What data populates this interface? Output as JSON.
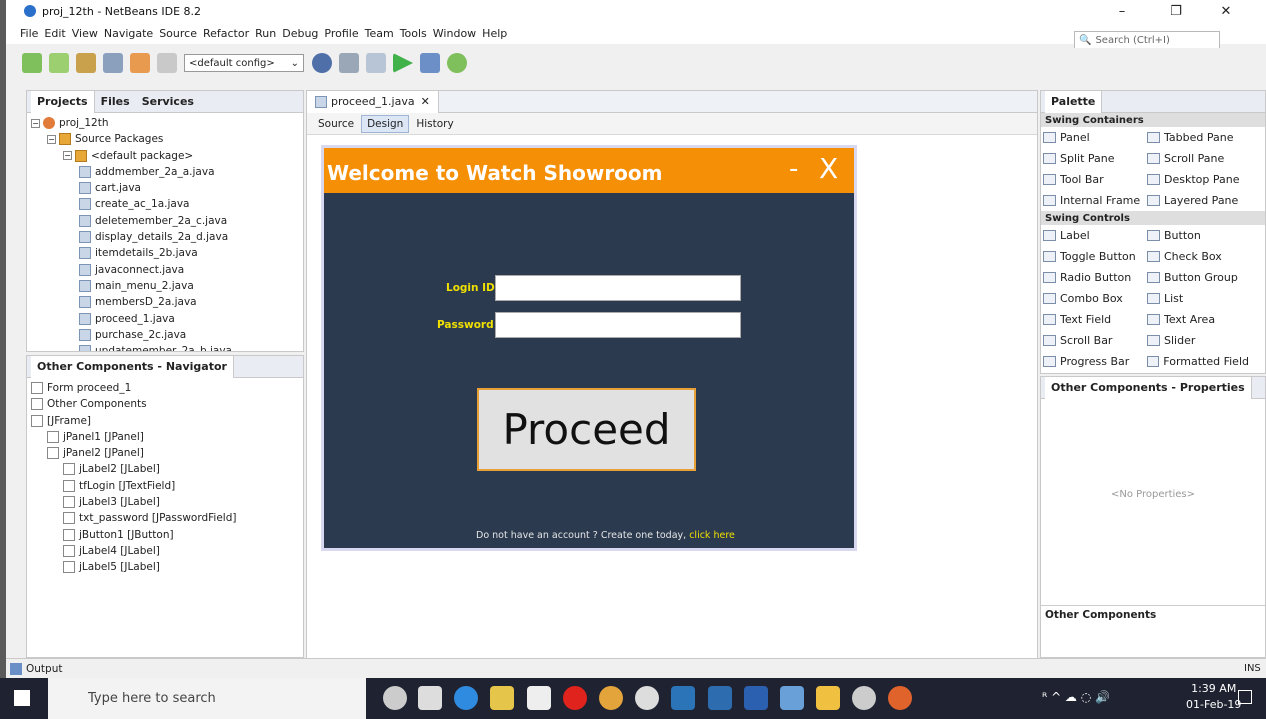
{
  "window": {
    "title": "proj_12th - NetBeans IDE 8.2",
    "minimize": "–",
    "maximize": "❐",
    "close": "✕"
  },
  "menu": [
    "File",
    "Edit",
    "View",
    "Navigate",
    "Source",
    "Refactor",
    "Run",
    "Debug",
    "Profile",
    "Team",
    "Tools",
    "Window",
    "Help"
  ],
  "search": {
    "placeholder": "Search (Ctrl+I)"
  },
  "toolbar": {
    "config": "<default config>"
  },
  "projects": {
    "tabs": [
      "Projects",
      "Files",
      "Services"
    ],
    "tree": [
      {
        "label": "proj_12th",
        "indent": 0,
        "icon": "proj"
      },
      {
        "label": "Source Packages",
        "indent": 1,
        "icon": "pkg"
      },
      {
        "label": "<default package>",
        "indent": 2,
        "icon": "pkg"
      },
      {
        "label": "addmember_2a_a.java",
        "indent": 3,
        "icon": "file"
      },
      {
        "label": "cart.java",
        "indent": 3,
        "icon": "file"
      },
      {
        "label": "create_ac_1a.java",
        "indent": 3,
        "icon": "file"
      },
      {
        "label": "deletemember_2a_c.java",
        "indent": 3,
        "icon": "file"
      },
      {
        "label": "display_details_2a_d.java",
        "indent": 3,
        "icon": "file"
      },
      {
        "label": "itemdetails_2b.java",
        "indent": 3,
        "icon": "file"
      },
      {
        "label": "javaconnect.java",
        "indent": 3,
        "icon": "file"
      },
      {
        "label": "main_menu_2.java",
        "indent": 3,
        "icon": "file"
      },
      {
        "label": "membersD_2a.java",
        "indent": 3,
        "icon": "file"
      },
      {
        "label": "proceed_1.java",
        "indent": 3,
        "icon": "file"
      },
      {
        "label": "purchase_2c.java",
        "indent": 3,
        "icon": "file"
      },
      {
        "label": "updatemember_2a_b.java",
        "indent": 3,
        "icon": "file"
      }
    ]
  },
  "navigator": {
    "title": "Other Components - Navigator",
    "tree": [
      {
        "label": "Form proceed_1",
        "indent": 0
      },
      {
        "label": "Other Components",
        "indent": 0
      },
      {
        "label": "[JFrame]",
        "indent": 0
      },
      {
        "label": "jPanel1 [JPanel]",
        "indent": 1
      },
      {
        "label": "jPanel2 [JPanel]",
        "indent": 1
      },
      {
        "label": "jLabel2 [JLabel]",
        "indent": 2
      },
      {
        "label": "tfLogin [JTextField]",
        "indent": 2
      },
      {
        "label": "jLabel3 [JLabel]",
        "indent": 2
      },
      {
        "label": "txt_password [JPasswordField]",
        "indent": 2
      },
      {
        "label": "jButton1 [JButton]",
        "indent": 2
      },
      {
        "label": "jLabel4 [JLabel]",
        "indent": 2
      },
      {
        "label": "jLabel5 [JLabel]",
        "indent": 2
      }
    ]
  },
  "editor": {
    "tab": "proceed_1.java",
    "views": [
      "Source",
      "Design",
      "History"
    ]
  },
  "form": {
    "title": "Welcome to Watch Showroom",
    "min": "-",
    "close": "X",
    "login_label": "Login ID",
    "password_label": "Password",
    "button": "Proceed",
    "note": "Do not have an account ? Create one today,",
    "link": "click here"
  },
  "palette": {
    "title": "Palette",
    "containers_title": "Swing Containers",
    "containers": [
      "Panel",
      "Tabbed Pane",
      "Split Pane",
      "Scroll Pane",
      "Tool Bar",
      "Desktop Pane",
      "Internal Frame",
      "Layered Pane"
    ],
    "controls_title": "Swing Controls",
    "controls": [
      "Label",
      "Button",
      "Toggle Button",
      "Check Box",
      "Radio Button",
      "Button Group",
      "Combo Box",
      "List",
      "Text Field",
      "Text Area",
      "Scroll Bar",
      "Slider",
      "Progress Bar",
      "Formatted Field"
    ]
  },
  "properties": {
    "title": "Other Components - Properties",
    "empty": "<No Properties>",
    "footer": "Other Components"
  },
  "status": {
    "output": "Output",
    "ins": "INS"
  },
  "taskbar": {
    "search_placeholder": "Type here to search",
    "time": "1:39 AM",
    "date": "01-Feb-19"
  }
}
